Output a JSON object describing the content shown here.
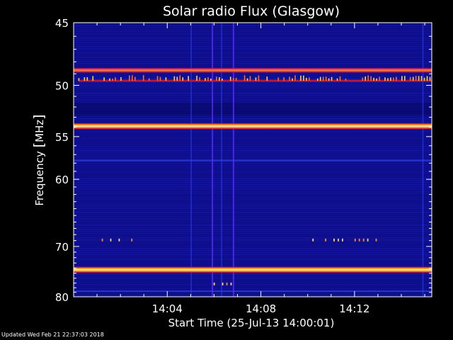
{
  "chart_data": {
    "type": "heatmap",
    "title": "Solar radio Flux (Glasgow)",
    "ylabel_parts": [
      "Frequency ",
      "[",
      "MHz",
      "]"
    ],
    "xlabel": "Start Time (25-Jul-13 14:00:01)",
    "x_ticks": [
      "14:04",
      "14:08",
      "14:12"
    ],
    "x_tick_minutes": [
      4,
      8,
      12
    ],
    "x_range_minutes": [
      0.0,
      15.3
    ],
    "y_ticks": [
      "45",
      "50",
      "55",
      "60",
      "70",
      "80"
    ],
    "y_tick_values": [
      45,
      50,
      55,
      60,
      70,
      80
    ],
    "y_range_mhz": [
      45,
      80
    ],
    "y_scale": "reciprocal (frequency increases downward)",
    "colors": {
      "background": "#000000",
      "plot_bg": "#0d0d8a",
      "hot": "#ffef66",
      "warm": "#ff4a1f"
    },
    "bright_bands_mhz": [
      {
        "freq": 48.7,
        "intensity": "high"
      },
      {
        "freq": 53.9,
        "intensity": "very high"
      },
      {
        "freq": 74.3,
        "intensity": "very high"
      }
    ],
    "bursty_band_mhz": [
      {
        "freq": 49.6,
        "from_minute": 0.2,
        "to_minute": 15.3
      }
    ],
    "minor_blips": [
      {
        "freq": 68.9,
        "from_minute": 1.2,
        "to_minute": 2.6
      },
      {
        "freq": 68.9,
        "from_minute": 10.2,
        "to_minute": 11.5
      },
      {
        "freq": 68.9,
        "from_minute": 12.0,
        "to_minute": 13.0
      },
      {
        "freq": 77.2,
        "from_minute": 5.8,
        "to_minute": 6.8
      }
    ],
    "vertical_features_minute": [
      5.0,
      5.9,
      6.3,
      6.8,
      14.9
    ]
  },
  "footer": "Updated Wed Feb 21 22:37:03 2018"
}
